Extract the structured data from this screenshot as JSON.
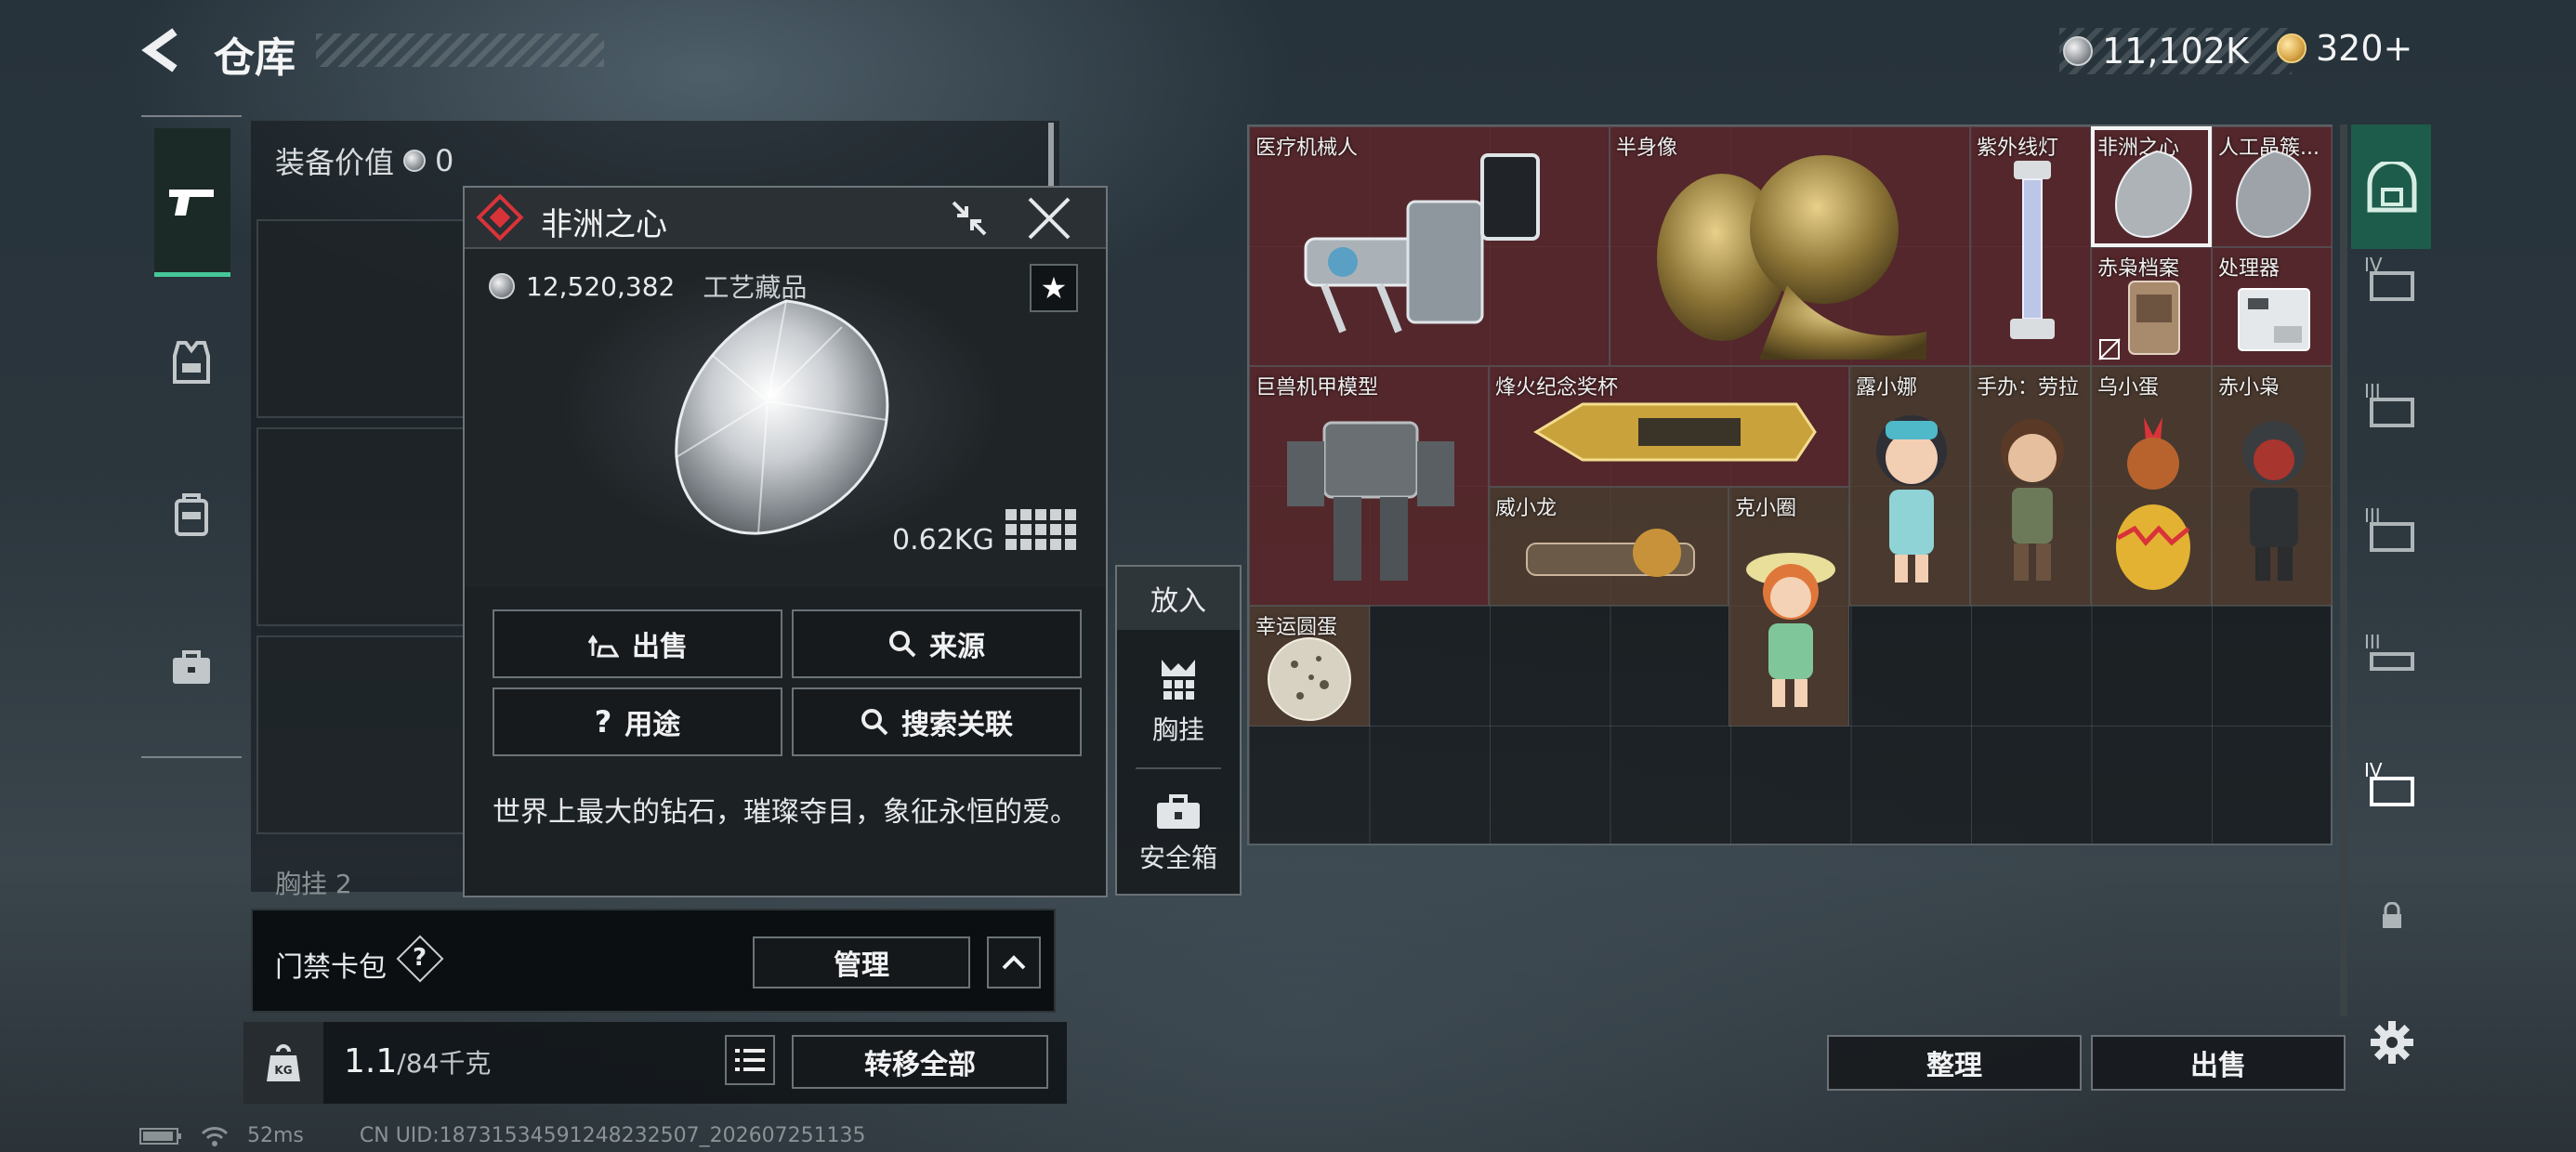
{
  "header": {
    "back_icon": "chevron-left-icon",
    "title": "仓库",
    "currency_silver": "11,102K",
    "currency_gold": "320+"
  },
  "left_nav": {
    "items": [
      {
        "icon": "pistol-icon",
        "active": true
      },
      {
        "icon": "armor-vest-icon",
        "active": false
      },
      {
        "icon": "backpack-icon",
        "active": false
      },
      {
        "icon": "briefcase-icon",
        "active": false
      }
    ]
  },
  "equipment": {
    "value_label": "装备价值",
    "value": "0",
    "chest_label": "胸挂",
    "chest_count": "2"
  },
  "card_pack": {
    "label": "门禁卡包",
    "help": "?",
    "manage_label": "管理"
  },
  "weight_bar": {
    "current": "1.1",
    "max": "/84千克",
    "transfer_label": "转移全部"
  },
  "popup": {
    "item_name": "非洲之心",
    "price": "12,520,382",
    "category": "工艺藏品",
    "weight": "0.62KG",
    "sell_label": "出售",
    "source_label": "来源",
    "usage_label": "用途",
    "search_label": "搜索关联",
    "description": "世界上最大的钻石，璀璨夺目，象征永恒的爱。"
  },
  "put_in": {
    "title": "放入",
    "items": [
      {
        "label": "胸挂",
        "icon": "chest-rig-icon"
      },
      {
        "label": "安全箱",
        "icon": "safe-box-icon"
      }
    ]
  },
  "inventory": {
    "items": [
      {
        "label": "医疗机械人",
        "color": "red"
      },
      {
        "label": "半身像",
        "color": "red"
      },
      {
        "label": "紫外线灯",
        "color": "red"
      },
      {
        "label": "非洲之心",
        "color": "red",
        "selected": true
      },
      {
        "label": "人工晶簇...",
        "color": "red"
      },
      {
        "label": "赤枭档案",
        "color": "red"
      },
      {
        "label": "处理器",
        "color": "red"
      },
      {
        "label": "巨兽机甲模型",
        "color": "red"
      },
      {
        "label": "烽火纪念奖杯",
        "color": "red"
      },
      {
        "label": "露小娜",
        "color": "brown"
      },
      {
        "label": "手办：劳拉",
        "color": "brown"
      },
      {
        "label": "乌小蛋",
        "color": "brown"
      },
      {
        "label": "赤小枭",
        "color": "brown"
      },
      {
        "label": "威小龙",
        "color": "brown"
      },
      {
        "label": "克小圈",
        "color": "brown"
      },
      {
        "label": "幸运圆蛋",
        "color": "brown"
      }
    ],
    "sort_label": "整理",
    "sell_label": "出售"
  },
  "right_tabs": [
    "IV",
    "III",
    "III",
    "III",
    "IV"
  ],
  "status_bar": {
    "ping": "52ms",
    "uid": "CN UID:1873153459124823​2507_202607251135"
  },
  "colors": {
    "accent_green": "#48c79a",
    "red_quality": "#642a2e",
    "brown_quality": "#56403a",
    "danger_red": "#d9333a"
  }
}
